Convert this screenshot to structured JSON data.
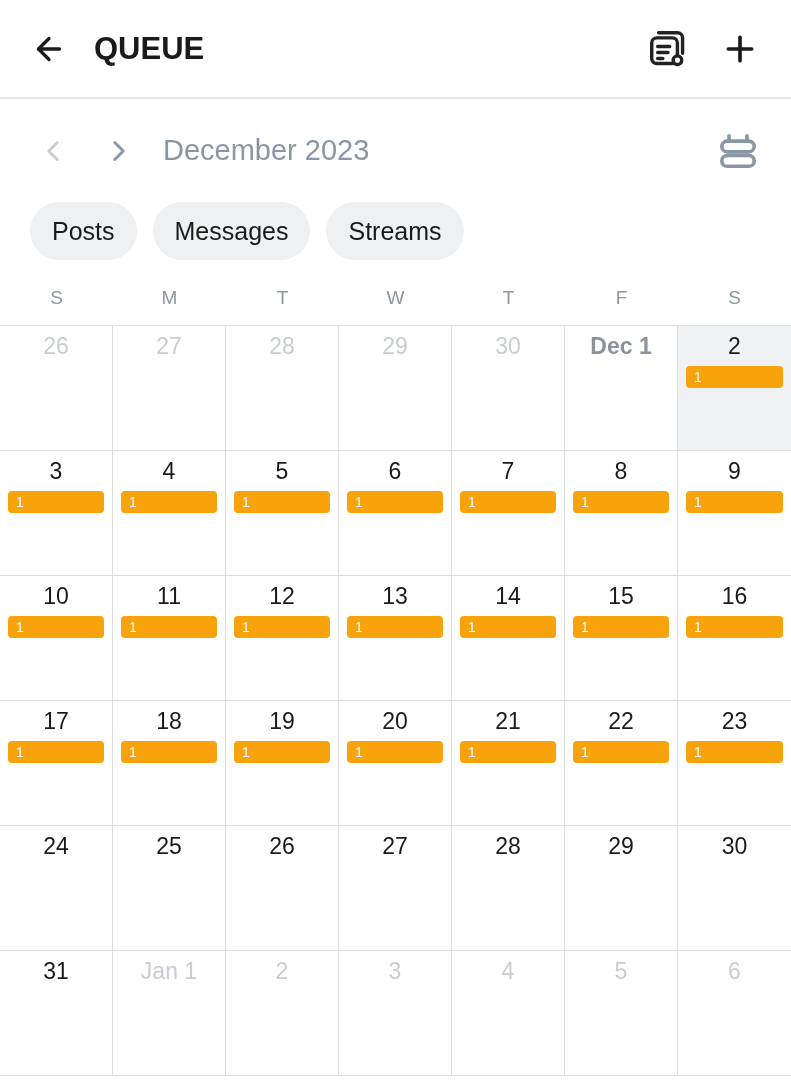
{
  "header": {
    "title": "QUEUE"
  },
  "month_nav": {
    "title": "December 2023",
    "prev_disabled": true,
    "next_disabled": false
  },
  "filters": [
    {
      "label": "Posts",
      "selected": false
    },
    {
      "label": "Messages",
      "selected": false
    },
    {
      "label": "Streams",
      "selected": false
    }
  ],
  "weekdays": [
    "S",
    "M",
    "T",
    "W",
    "T",
    "F",
    "S"
  ],
  "weeks": [
    [
      {
        "label": "26",
        "kind": "outside",
        "selected": false
      },
      {
        "label": "27",
        "kind": "outside",
        "selected": false
      },
      {
        "label": "28",
        "kind": "outside",
        "selected": false
      },
      {
        "label": "29",
        "kind": "outside",
        "selected": false
      },
      {
        "label": "30",
        "kind": "outside",
        "selected": false
      },
      {
        "label": "Dec 1",
        "kind": "past",
        "selected": false
      },
      {
        "label": "2",
        "kind": "current",
        "selected": true,
        "badge": "1"
      }
    ],
    [
      {
        "label": "3",
        "kind": "current",
        "selected": false,
        "badge": "1"
      },
      {
        "label": "4",
        "kind": "current",
        "selected": false,
        "badge": "1"
      },
      {
        "label": "5",
        "kind": "current",
        "selected": false,
        "badge": "1"
      },
      {
        "label": "6",
        "kind": "current",
        "selected": false,
        "badge": "1"
      },
      {
        "label": "7",
        "kind": "current",
        "selected": false,
        "badge": "1"
      },
      {
        "label": "8",
        "kind": "current",
        "selected": false,
        "badge": "1"
      },
      {
        "label": "9",
        "kind": "current",
        "selected": false,
        "badge": "1"
      }
    ],
    [
      {
        "label": "10",
        "kind": "current",
        "selected": false,
        "badge": "1"
      },
      {
        "label": "11",
        "kind": "current",
        "selected": false,
        "badge": "1"
      },
      {
        "label": "12",
        "kind": "current",
        "selected": false,
        "badge": "1"
      },
      {
        "label": "13",
        "kind": "current",
        "selected": false,
        "badge": "1"
      },
      {
        "label": "14",
        "kind": "current",
        "selected": false,
        "badge": "1"
      },
      {
        "label": "15",
        "kind": "current",
        "selected": false,
        "badge": "1"
      },
      {
        "label": "16",
        "kind": "current",
        "selected": false,
        "badge": "1"
      }
    ],
    [
      {
        "label": "17",
        "kind": "current",
        "selected": false,
        "badge": "1"
      },
      {
        "label": "18",
        "kind": "current",
        "selected": false,
        "badge": "1"
      },
      {
        "label": "19",
        "kind": "current",
        "selected": false,
        "badge": "1"
      },
      {
        "label": "20",
        "kind": "current",
        "selected": false,
        "badge": "1"
      },
      {
        "label": "21",
        "kind": "current",
        "selected": false,
        "badge": "1"
      },
      {
        "label": "22",
        "kind": "current",
        "selected": false,
        "badge": "1"
      },
      {
        "label": "23",
        "kind": "current",
        "selected": false,
        "badge": "1"
      }
    ],
    [
      {
        "label": "24",
        "kind": "current",
        "selected": false
      },
      {
        "label": "25",
        "kind": "current",
        "selected": false
      },
      {
        "label": "26",
        "kind": "current",
        "selected": false
      },
      {
        "label": "27",
        "kind": "current",
        "selected": false
      },
      {
        "label": "28",
        "kind": "current",
        "selected": false
      },
      {
        "label": "29",
        "kind": "current",
        "selected": false
      },
      {
        "label": "30",
        "kind": "current",
        "selected": false
      }
    ],
    [
      {
        "label": "31",
        "kind": "current",
        "selected": false
      },
      {
        "label": "Jan 1",
        "kind": "outside",
        "selected": false
      },
      {
        "label": "2",
        "kind": "outside",
        "selected": false
      },
      {
        "label": "3",
        "kind": "outside",
        "selected": false
      },
      {
        "label": "4",
        "kind": "outside",
        "selected": false
      },
      {
        "label": "5",
        "kind": "outside",
        "selected": false
      },
      {
        "label": "6",
        "kind": "outside",
        "selected": false
      }
    ]
  ]
}
